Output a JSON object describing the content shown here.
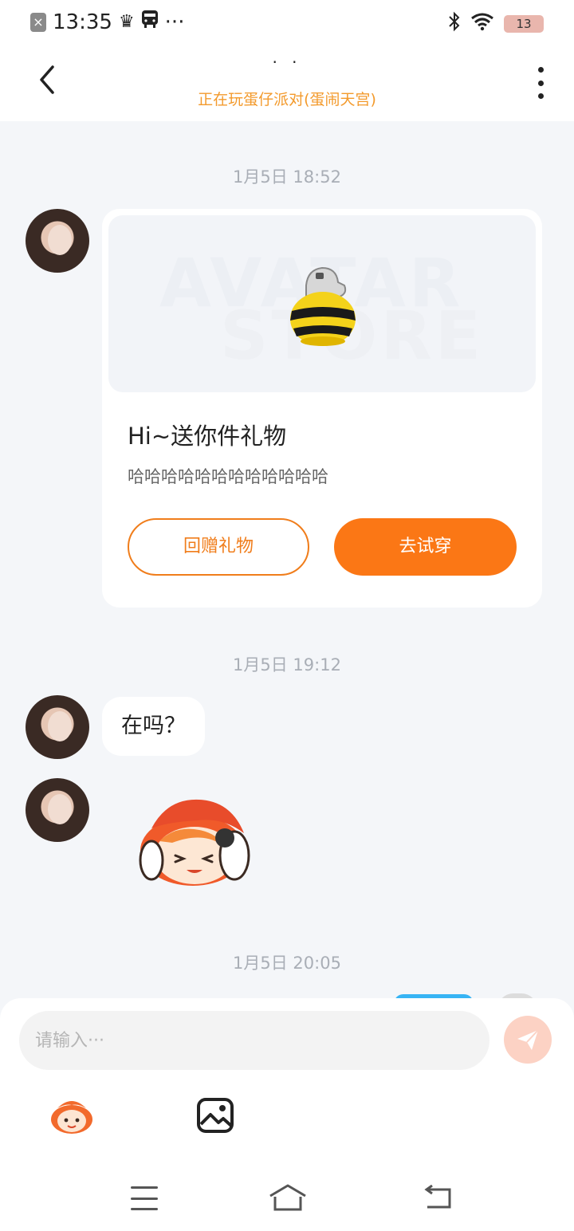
{
  "status_bar": {
    "time": "13:35",
    "left_icons": [
      "close-box-icon",
      "crown-icon",
      "bus-icon"
    ],
    "more": "···",
    "right_icons": [
      "bluetooth-icon",
      "wifi-icon"
    ],
    "battery": "13"
  },
  "header": {
    "title": "· ·",
    "subtitle": "正在玩蛋仔派对(蛋闹天宫)"
  },
  "messages": {
    "ts1": "1月5日 18:52",
    "gift": {
      "watermark_top": "AVATAR",
      "watermark_bottom": "STORE",
      "title": "Hi~送你件礼物",
      "subtitle": "哈哈哈哈哈哈哈哈哈哈哈哈",
      "return_label": "回赠礼物",
      "try_label": "去试穿"
    },
    "ts2": "1月5日 19:12",
    "text1": "在吗？",
    "ts3": "1月5日 20:05"
  },
  "input": {
    "placeholder": "请输入···"
  },
  "colors": {
    "accent_orange": "#fb7715",
    "subtitle_orange": "#f39a2c",
    "background": "#f4f6f9"
  }
}
